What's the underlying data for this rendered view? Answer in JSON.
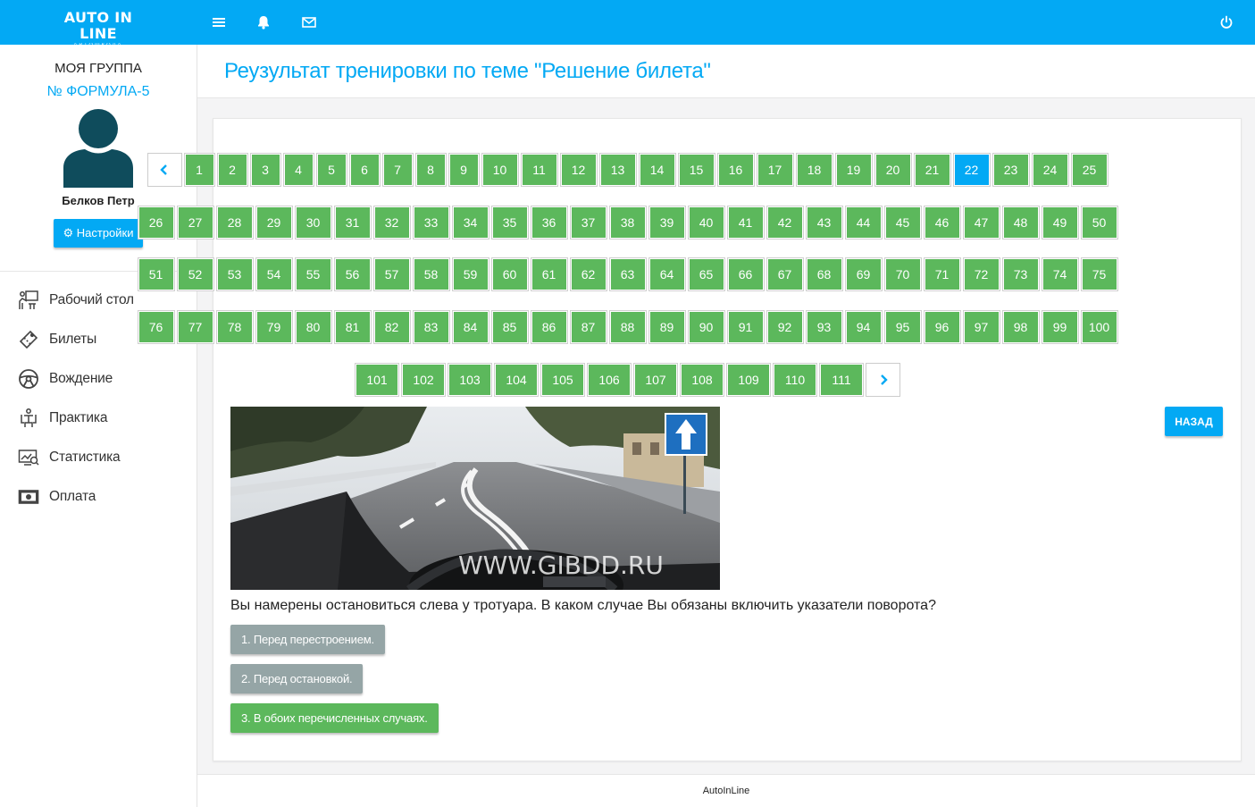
{
  "topbar": {
    "logo_main": "AUTO IN LINE",
    "logo_sub": "АВТОШКОЛА",
    "icons": [
      "menu-icon",
      "bell-icon",
      "envelope-icon",
      "power-icon"
    ],
    "color": "#03a9f4"
  },
  "sidebar": {
    "group_title": "МОЯ ГРУППА",
    "group_name": "№ ФОРМУЛА-5",
    "user_name": "Белков Петр",
    "settings_label": "⚙ Настройки",
    "nav": [
      {
        "label": "Рабочий стол",
        "icon": "desktop-presentation-icon"
      },
      {
        "label": "Билеты",
        "icon": "ticket-icon"
      },
      {
        "label": "Вождение",
        "icon": "steering-wheel-icon"
      },
      {
        "label": "Практика",
        "icon": "practice-icon"
      },
      {
        "label": "Статистика",
        "icon": "monitor-stats-icon"
      },
      {
        "label": "Оплата",
        "icon": "money-icon"
      }
    ]
  },
  "main": {
    "title": "Реузультат тренировки по теме \"Решение билета\"",
    "back_label": "НАЗАД",
    "active_question": 22,
    "total_questions": 111,
    "image_watermark": "WWW.GIBDD.RU",
    "question": "Вы намерены остановиться слева у тротуара. В каком случае Вы обязаны включить указатели поворота?",
    "answers": [
      {
        "label": "1. Перед перестроением.",
        "state": "gray"
      },
      {
        "label": "2. Перед остановкой.",
        "state": "gray"
      },
      {
        "label": "3. В обоих перечисленных случаях.",
        "state": "green"
      }
    ]
  },
  "colors": {
    "accent": "#03a9f4",
    "correct": "#5cb85c",
    "neutral": "#95a5a6"
  },
  "footer": {
    "text": "AutoInLine"
  }
}
